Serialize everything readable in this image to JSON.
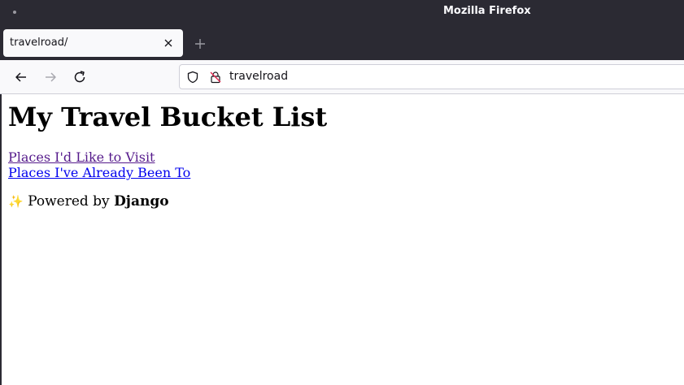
{
  "window": {
    "title": "Mozilla Firefox"
  },
  "tabs": [
    {
      "label": "travelroad/",
      "active": true
    }
  ],
  "navbar": {
    "url": "travelroad"
  },
  "page": {
    "heading": "My Travel Bucket List",
    "links": [
      {
        "label": "Places I'd Like to Visit",
        "visited": true
      },
      {
        "label": "Places I've Already Been To",
        "visited": false
      }
    ],
    "footer": {
      "sparkle": "✨",
      "prefix": "Powered by",
      "brand": "Django"
    }
  },
  "colors": {
    "chrome": "#2b2a33",
    "toolbar": "#f9f9fb",
    "visited_link": "#551a8b",
    "link": "#0000ee"
  },
  "icons": [
    "back-icon",
    "forward-icon",
    "reload-icon",
    "shield-icon",
    "insecure-lock-icon",
    "close-icon",
    "plus-icon"
  ]
}
